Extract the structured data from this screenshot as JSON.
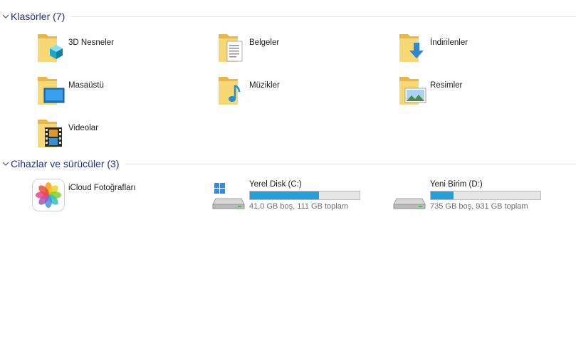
{
  "groups": {
    "folders": {
      "title": "Klasörler (7)"
    },
    "devices": {
      "title": "Cihazlar ve sürücüler (3)"
    }
  },
  "folders": [
    {
      "label": "3D Nesneler",
      "icon": "3d-objects-icon"
    },
    {
      "label": "Belgeler",
      "icon": "documents-icon"
    },
    {
      "label": "İndirilenler",
      "icon": "downloads-icon"
    },
    {
      "label": "Masaüstü",
      "icon": "desktop-icon"
    },
    {
      "label": "Müzikler",
      "icon": "music-icon"
    },
    {
      "label": "Resimler",
      "icon": "pictures-icon"
    },
    {
      "label": "Videolar",
      "icon": "videos-icon"
    }
  ],
  "devices": {
    "icloud": {
      "label": "iCloud Fotoğrafları",
      "icon": "icloud-photos-icon"
    },
    "drives": [
      {
        "name": "Yerel Disk (C:)",
        "free_text": "41,0 GB boş, 111 GB toplam",
        "used_fraction": 0.63,
        "icon": "windows-drive-icon"
      },
      {
        "name": "Yeni Birim (D:)",
        "free_text": "735 GB boş, 931 GB toplam",
        "used_fraction": 0.21,
        "icon": "hard-drive-icon"
      }
    ]
  },
  "colors": {
    "accent": "#1e3287",
    "bar_fill": "#26a0da",
    "folder": "#f8d775"
  }
}
